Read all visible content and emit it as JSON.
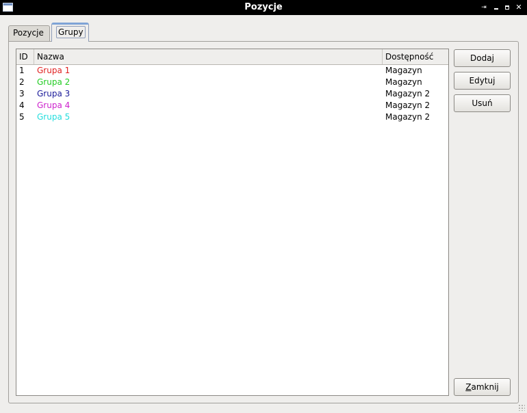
{
  "window": {
    "title": "Pozycje"
  },
  "tabs": [
    {
      "label": "Pozycje",
      "active": false
    },
    {
      "label": "Grupy",
      "active": true
    }
  ],
  "table": {
    "columns": [
      "ID",
      "Nazwa",
      "Dostępność"
    ],
    "rows": [
      {
        "id": "1",
        "name": "Grupa 1",
        "availability": "Magazyn",
        "color": "#e02020"
      },
      {
        "id": "2",
        "name": "Grupa 2",
        "availability": "Magazyn",
        "color": "#22cc22"
      },
      {
        "id": "3",
        "name": "Grupa 3",
        "availability": "Magazyn 2",
        "color": "#1a1a99"
      },
      {
        "id": "4",
        "name": "Grupa 4",
        "availability": "Magazyn 2",
        "color": "#cc22cc"
      },
      {
        "id": "5",
        "name": "Grupa 5",
        "availability": "Magazyn 2",
        "color": "#22dddd"
      }
    ]
  },
  "buttons": {
    "add": "Dodaj",
    "edit": "Edytuj",
    "delete": "Usuń",
    "close_mnemonic": "Z",
    "close_rest": "amknij"
  },
  "icons": {
    "app": "window-icon",
    "pin": "pin-icon",
    "minimize": "minimize-icon",
    "maximize": "maximize-icon",
    "close": "close-icon"
  }
}
